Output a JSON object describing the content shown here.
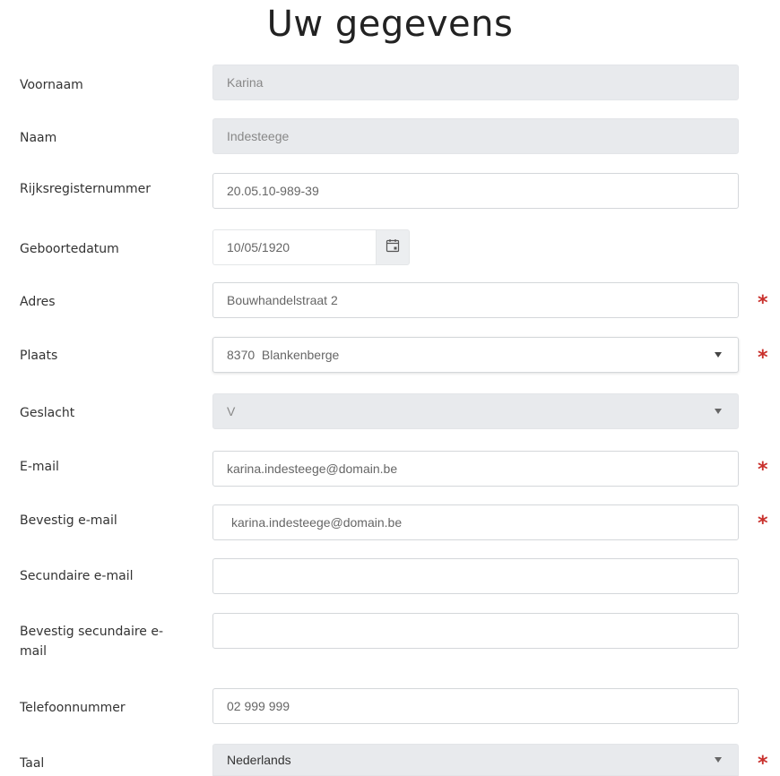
{
  "page": {
    "title": "Uw gegevens"
  },
  "fields": {
    "voornaam": {
      "label": "Voornaam",
      "value": "Karina"
    },
    "naam": {
      "label": "Naam",
      "value": "Indesteege"
    },
    "rijksregisternummer": {
      "label": "Rijksregisternummer",
      "value": "20.05.10-989-39"
    },
    "geboortedatum": {
      "label": "Geboortedatum",
      "value": "10/05/1920",
      "icon": "calendar-icon"
    },
    "adres": {
      "label": "Adres",
      "value": "Bouwhandelstraat 2",
      "required": "*"
    },
    "plaats": {
      "label": "Plaats",
      "value": "8370  Blankenberge",
      "required": "*"
    },
    "geslacht": {
      "label": "Geslacht",
      "value": "V"
    },
    "email": {
      "label": "E-mail",
      "value": "karina.indesteege@domain.be",
      "required": "*"
    },
    "bevestig_email": {
      "label": "Bevestig e-mail",
      "value": "karina.indesteege@domain.be",
      "required": "*"
    },
    "secundaire_email": {
      "label": "Secundaire e-mail",
      "value": ""
    },
    "bevestig_secundaire_email": {
      "label_line1": "Bevestig secundaire e-",
      "label_line2": "mail",
      "value": ""
    },
    "telefoonnummer": {
      "label": "Telefoonnummer",
      "value": "02 999 999"
    },
    "taal": {
      "label": "Taal",
      "value": "Nederlands",
      "required": "*"
    }
  },
  "colors": {
    "required": "#c9302c",
    "disabled_bg": "#e8eaed",
    "border": "#d4d7da"
  }
}
